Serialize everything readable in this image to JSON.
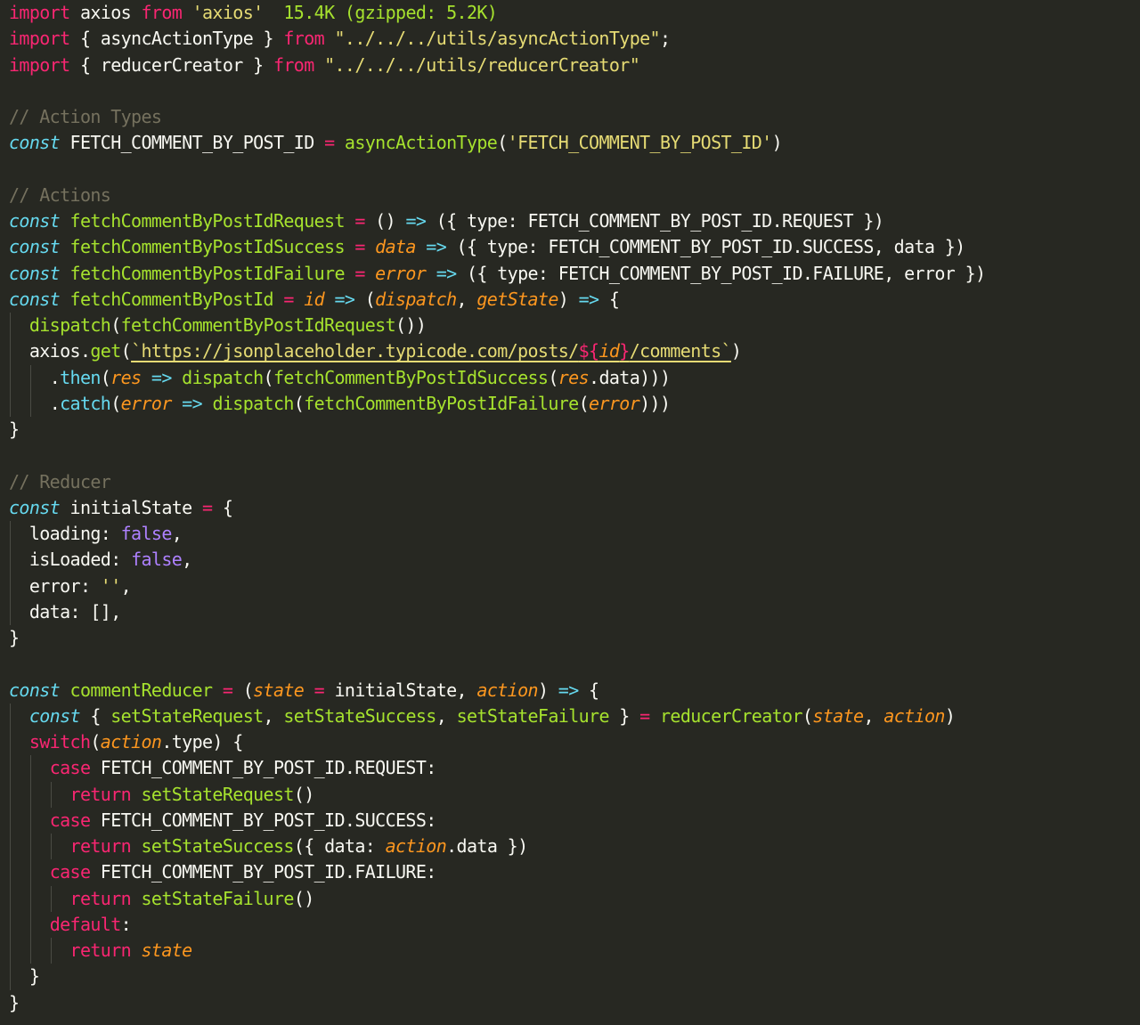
{
  "editor": {
    "theme_colors": {
      "background": "#272822",
      "keyword": "#f92672",
      "string": "#e6db74",
      "comment": "#75715e",
      "function": "#a6e22e",
      "storage": "#66d9ef",
      "parameter": "#fd971f",
      "constant": "#ae81ff",
      "plain": "#f8f8f2"
    },
    "lines": [
      {
        "indent": 0,
        "tokens": [
          {
            "t": "kw",
            "v": "import"
          },
          {
            "t": "txt",
            "v": " axios "
          },
          {
            "t": "kw",
            "v": "from"
          },
          {
            "t": "txt",
            "v": " "
          },
          {
            "t": "str",
            "v": "'axios'"
          },
          {
            "t": "txt",
            "v": "  "
          },
          {
            "t": "hint",
            "v": "15.4K (gzipped: 5.2K)"
          }
        ]
      },
      {
        "indent": 0,
        "tokens": [
          {
            "t": "kw",
            "v": "import"
          },
          {
            "t": "txt",
            "v": " { asyncActionType } "
          },
          {
            "t": "kw",
            "v": "from"
          },
          {
            "t": "txt",
            "v": " "
          },
          {
            "t": "str",
            "v": "\"../../../utils/asyncActionType\""
          },
          {
            "t": "txt",
            "v": ";"
          }
        ]
      },
      {
        "indent": 0,
        "tokens": [
          {
            "t": "kw",
            "v": "import"
          },
          {
            "t": "txt",
            "v": " { reducerCreator } "
          },
          {
            "t": "kw",
            "v": "from"
          },
          {
            "t": "txt",
            "v": " "
          },
          {
            "t": "str",
            "v": "\"../../../utils/reducerCreator\""
          }
        ]
      },
      {
        "indent": 0,
        "tokens": []
      },
      {
        "indent": 0,
        "tokens": [
          {
            "t": "cmt",
            "v": "// Action Types"
          }
        ]
      },
      {
        "indent": 0,
        "tokens": [
          {
            "t": "sto",
            "v": "const"
          },
          {
            "t": "txt",
            "v": " FETCH_COMMENT_BY_POST_ID "
          },
          {
            "t": "kw",
            "v": "="
          },
          {
            "t": "txt",
            "v": " "
          },
          {
            "t": "fn",
            "v": "asyncActionType"
          },
          {
            "t": "txt",
            "v": "("
          },
          {
            "t": "str",
            "v": "'FETCH_COMMENT_BY_POST_ID'"
          },
          {
            "t": "txt",
            "v": ")"
          }
        ]
      },
      {
        "indent": 0,
        "tokens": []
      },
      {
        "indent": 0,
        "tokens": [
          {
            "t": "cmt",
            "v": "// Actions"
          }
        ]
      },
      {
        "indent": 0,
        "tokens": [
          {
            "t": "sto",
            "v": "const"
          },
          {
            "t": "txt",
            "v": " "
          },
          {
            "t": "fn",
            "v": "fetchCommentByPostIdRequest"
          },
          {
            "t": "txt",
            "v": " "
          },
          {
            "t": "kw",
            "v": "="
          },
          {
            "t": "txt",
            "v": " () "
          },
          {
            "t": "arr",
            "v": "=>"
          },
          {
            "t": "txt",
            "v": " ({ type: FETCH_COMMENT_BY_POST_ID.REQUEST })"
          }
        ]
      },
      {
        "indent": 0,
        "tokens": [
          {
            "t": "sto",
            "v": "const"
          },
          {
            "t": "txt",
            "v": " "
          },
          {
            "t": "fn",
            "v": "fetchCommentByPostIdSuccess"
          },
          {
            "t": "txt",
            "v": " "
          },
          {
            "t": "kw",
            "v": "="
          },
          {
            "t": "txt",
            "v": " "
          },
          {
            "t": "par",
            "v": "data"
          },
          {
            "t": "txt",
            "v": " "
          },
          {
            "t": "arr",
            "v": "=>"
          },
          {
            "t": "txt",
            "v": " ({ type: FETCH_COMMENT_BY_POST_ID.SUCCESS, data })"
          }
        ]
      },
      {
        "indent": 0,
        "tokens": [
          {
            "t": "sto",
            "v": "const"
          },
          {
            "t": "txt",
            "v": " "
          },
          {
            "t": "fn",
            "v": "fetchCommentByPostIdFailure"
          },
          {
            "t": "txt",
            "v": " "
          },
          {
            "t": "kw",
            "v": "="
          },
          {
            "t": "txt",
            "v": " "
          },
          {
            "t": "par",
            "v": "error"
          },
          {
            "t": "txt",
            "v": " "
          },
          {
            "t": "arr",
            "v": "=>"
          },
          {
            "t": "txt",
            "v": " ({ type: FETCH_COMMENT_BY_POST_ID.FAILURE, error })"
          }
        ]
      },
      {
        "indent": 0,
        "tokens": [
          {
            "t": "sto",
            "v": "const"
          },
          {
            "t": "txt",
            "v": " "
          },
          {
            "t": "fn",
            "v": "fetchCommentByPostId"
          },
          {
            "t": "txt",
            "v": " "
          },
          {
            "t": "kw",
            "v": "="
          },
          {
            "t": "txt",
            "v": " "
          },
          {
            "t": "par",
            "v": "id"
          },
          {
            "t": "txt",
            "v": " "
          },
          {
            "t": "arr",
            "v": "=>"
          },
          {
            "t": "txt",
            "v": " ("
          },
          {
            "t": "par",
            "v": "dispatch"
          },
          {
            "t": "txt",
            "v": ", "
          },
          {
            "t": "par",
            "v": "getState"
          },
          {
            "t": "txt",
            "v": ") "
          },
          {
            "t": "arr",
            "v": "=>"
          },
          {
            "t": "txt",
            "v": " {"
          }
        ]
      },
      {
        "indent": 1,
        "tokens": [
          {
            "t": "fn",
            "v": "dispatch"
          },
          {
            "t": "txt",
            "v": "("
          },
          {
            "t": "fn",
            "v": "fetchCommentByPostIdRequest"
          },
          {
            "t": "txt",
            "v": "())"
          }
        ]
      },
      {
        "indent": 1,
        "tokens": [
          {
            "t": "txt",
            "v": "axios."
          },
          {
            "t": "fn",
            "v": "get"
          },
          {
            "t": "txt",
            "v": "("
          },
          {
            "t": "url",
            "v": "`https://jsonplaceholder.typicode.com/posts/"
          },
          {
            "t": "tpl",
            "v": "${"
          },
          {
            "t": "tplvar",
            "v": "id"
          },
          {
            "t": "tpl",
            "v": "}"
          },
          {
            "t": "url",
            "v": "/comments`"
          },
          {
            "t": "txt",
            "v": ")"
          }
        ]
      },
      {
        "indent": 2,
        "tokens": [
          {
            "t": "txt",
            "v": "."
          },
          {
            "t": "arr",
            "v": "then"
          },
          {
            "t": "txt",
            "v": "("
          },
          {
            "t": "par",
            "v": "res"
          },
          {
            "t": "txt",
            "v": " "
          },
          {
            "t": "arr",
            "v": "=>"
          },
          {
            "t": "txt",
            "v": " "
          },
          {
            "t": "fn",
            "v": "dispatch"
          },
          {
            "t": "txt",
            "v": "("
          },
          {
            "t": "fn",
            "v": "fetchCommentByPostIdSuccess"
          },
          {
            "t": "txt",
            "v": "("
          },
          {
            "t": "par",
            "v": "res"
          },
          {
            "t": "txt",
            "v": ".data)))"
          }
        ]
      },
      {
        "indent": 2,
        "tokens": [
          {
            "t": "txt",
            "v": "."
          },
          {
            "t": "arr",
            "v": "catch"
          },
          {
            "t": "txt",
            "v": "("
          },
          {
            "t": "par",
            "v": "error"
          },
          {
            "t": "txt",
            "v": " "
          },
          {
            "t": "arr",
            "v": "=>"
          },
          {
            "t": "txt",
            "v": " "
          },
          {
            "t": "fn",
            "v": "dispatch"
          },
          {
            "t": "txt",
            "v": "("
          },
          {
            "t": "fn",
            "v": "fetchCommentByPostIdFailure"
          },
          {
            "t": "txt",
            "v": "("
          },
          {
            "t": "par",
            "v": "error"
          },
          {
            "t": "txt",
            "v": ")))"
          }
        ]
      },
      {
        "indent": 0,
        "tokens": [
          {
            "t": "txt",
            "v": "}"
          }
        ]
      },
      {
        "indent": 0,
        "tokens": []
      },
      {
        "indent": 0,
        "tokens": [
          {
            "t": "cmt",
            "v": "// Reducer"
          }
        ]
      },
      {
        "indent": 0,
        "tokens": [
          {
            "t": "sto",
            "v": "const"
          },
          {
            "t": "txt",
            "v": " initialState "
          },
          {
            "t": "kw",
            "v": "="
          },
          {
            "t": "txt",
            "v": " {"
          }
        ]
      },
      {
        "indent": 1,
        "tokens": [
          {
            "t": "txt",
            "v": "loading: "
          },
          {
            "t": "num",
            "v": "false"
          },
          {
            "t": "txt",
            "v": ","
          }
        ]
      },
      {
        "indent": 1,
        "tokens": [
          {
            "t": "txt",
            "v": "isLoaded: "
          },
          {
            "t": "num",
            "v": "false"
          },
          {
            "t": "txt",
            "v": ","
          }
        ]
      },
      {
        "indent": 1,
        "tokens": [
          {
            "t": "txt",
            "v": "error: "
          },
          {
            "t": "str",
            "v": "''"
          },
          {
            "t": "txt",
            "v": ","
          }
        ]
      },
      {
        "indent": 1,
        "tokens": [
          {
            "t": "txt",
            "v": "data: [],"
          }
        ]
      },
      {
        "indent": 0,
        "tokens": [
          {
            "t": "txt",
            "v": "}"
          }
        ]
      },
      {
        "indent": 0,
        "tokens": []
      },
      {
        "indent": 0,
        "tokens": [
          {
            "t": "sto",
            "v": "const"
          },
          {
            "t": "txt",
            "v": " "
          },
          {
            "t": "fn",
            "v": "commentReducer"
          },
          {
            "t": "txt",
            "v": " "
          },
          {
            "t": "kw",
            "v": "="
          },
          {
            "t": "txt",
            "v": " ("
          },
          {
            "t": "par",
            "v": "state"
          },
          {
            "t": "txt",
            "v": " "
          },
          {
            "t": "kw",
            "v": "="
          },
          {
            "t": "txt",
            "v": " initialState, "
          },
          {
            "t": "par",
            "v": "action"
          },
          {
            "t": "txt",
            "v": ") "
          },
          {
            "t": "arr",
            "v": "=>"
          },
          {
            "t": "txt",
            "v": " {"
          }
        ]
      },
      {
        "indent": 1,
        "tokens": [
          {
            "t": "sto",
            "v": "const"
          },
          {
            "t": "txt",
            "v": " { "
          },
          {
            "t": "fn",
            "v": "setStateRequest"
          },
          {
            "t": "txt",
            "v": ", "
          },
          {
            "t": "fn",
            "v": "setStateSuccess"
          },
          {
            "t": "txt",
            "v": ", "
          },
          {
            "t": "fn",
            "v": "setStateFailure"
          },
          {
            "t": "txt",
            "v": " } "
          },
          {
            "t": "kw",
            "v": "="
          },
          {
            "t": "txt",
            "v": " "
          },
          {
            "t": "fn",
            "v": "reducerCreator"
          },
          {
            "t": "txt",
            "v": "("
          },
          {
            "t": "par",
            "v": "state"
          },
          {
            "t": "txt",
            "v": ", "
          },
          {
            "t": "par",
            "v": "action"
          },
          {
            "t": "txt",
            "v": ")"
          }
        ]
      },
      {
        "indent": 1,
        "tokens": [
          {
            "t": "kw",
            "v": "switch"
          },
          {
            "t": "txt",
            "v": "("
          },
          {
            "t": "par",
            "v": "action"
          },
          {
            "t": "txt",
            "v": ".type) {"
          }
        ]
      },
      {
        "indent": 2,
        "tokens": [
          {
            "t": "kw",
            "v": "case"
          },
          {
            "t": "txt",
            "v": " FETCH_COMMENT_BY_POST_ID.REQUEST:"
          }
        ]
      },
      {
        "indent": 3,
        "tokens": [
          {
            "t": "kw",
            "v": "return"
          },
          {
            "t": "txt",
            "v": " "
          },
          {
            "t": "fn",
            "v": "setStateRequest"
          },
          {
            "t": "txt",
            "v": "()"
          }
        ]
      },
      {
        "indent": 2,
        "tokens": [
          {
            "t": "kw",
            "v": "case"
          },
          {
            "t": "txt",
            "v": " FETCH_COMMENT_BY_POST_ID.SUCCESS:"
          }
        ]
      },
      {
        "indent": 3,
        "tokens": [
          {
            "t": "kw",
            "v": "return"
          },
          {
            "t": "txt",
            "v": " "
          },
          {
            "t": "fn",
            "v": "setStateSuccess"
          },
          {
            "t": "txt",
            "v": "({ data: "
          },
          {
            "t": "par",
            "v": "action"
          },
          {
            "t": "txt",
            "v": ".data })"
          }
        ]
      },
      {
        "indent": 2,
        "tokens": [
          {
            "t": "kw",
            "v": "case"
          },
          {
            "t": "txt",
            "v": " FETCH_COMMENT_BY_POST_ID.FAILURE:"
          }
        ]
      },
      {
        "indent": 3,
        "tokens": [
          {
            "t": "kw",
            "v": "return"
          },
          {
            "t": "txt",
            "v": " "
          },
          {
            "t": "fn",
            "v": "setStateFailure"
          },
          {
            "t": "txt",
            "v": "()"
          }
        ]
      },
      {
        "indent": 2,
        "tokens": [
          {
            "t": "kw",
            "v": "default"
          },
          {
            "t": "txt",
            "v": ":"
          }
        ]
      },
      {
        "indent": 3,
        "tokens": [
          {
            "t": "kw",
            "v": "return"
          },
          {
            "t": "txt",
            "v": " "
          },
          {
            "t": "par",
            "v": "state"
          }
        ]
      },
      {
        "indent": 1,
        "tokens": [
          {
            "t": "txt",
            "v": "}"
          }
        ]
      },
      {
        "indent": 0,
        "tokens": [
          {
            "t": "txt",
            "v": "}"
          }
        ]
      }
    ]
  }
}
